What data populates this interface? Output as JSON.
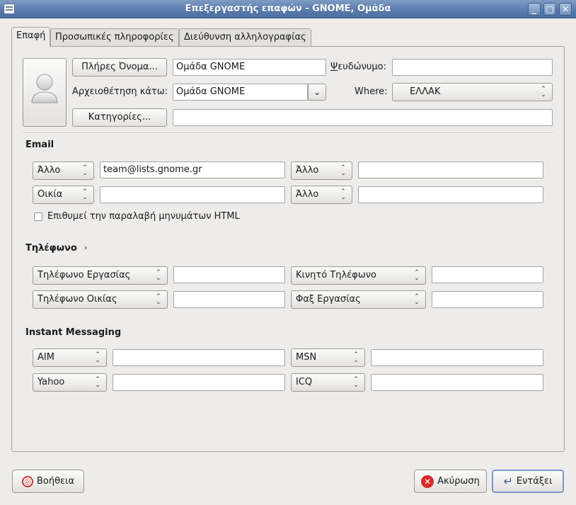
{
  "window": {
    "title": "Επεξεργαστής επαφών - GNOME, Ομάδα",
    "minimize_icon": "minimize-icon",
    "maximize_icon": "maximize-icon",
    "close_icon": "close-icon"
  },
  "tabs": [
    {
      "label": "Επαφή",
      "active": true
    },
    {
      "label": "Προσωπικές πληροφορίες",
      "active": false
    },
    {
      "label": "Διεύθυνση αλληλογραφίας",
      "active": false
    }
  ],
  "contact": {
    "full_name_button": "Πλήρες Όνομα...",
    "full_name_value": "Ομάδα GNOME",
    "nickname_label": "Ψευδώνυμο:",
    "nickname_value": "",
    "file_under_label": "Αρχειοθέτηση κάτω:",
    "file_under_value": "Ομάδα GNOME",
    "where_label": "Where:",
    "where_value": "ΕΛΛΑΚ",
    "categories_button": "Κατηγορίες...",
    "categories_value": "",
    "photo_icon": "person-icon"
  },
  "email": {
    "heading": "Email",
    "rows": [
      {
        "type1": "Άλλο",
        "value1": "team@lists.gnome.gr",
        "type2": "Άλλο",
        "value2": ""
      },
      {
        "type1": "Οικία",
        "value1": "",
        "type2": "Άλλο",
        "value2": ""
      }
    ],
    "html_checkbox_label": "Επιθυμεί την παραλαβή μηνυμάτων HTML",
    "html_checked": false
  },
  "phone": {
    "heading": "Τηλέφωνο",
    "expander_icon": "chevron-right-icon",
    "rows": [
      {
        "type1": "Τηλέφωνο Εργασίας",
        "value1": "",
        "type2": "Κινητό Τηλέφωνο",
        "value2": ""
      },
      {
        "type1": "Τηλέφωνο Οικίας",
        "value1": "",
        "type2": "Φαξ Εργασίας",
        "value2": ""
      }
    ]
  },
  "im": {
    "heading": "Instant Messaging",
    "rows": [
      {
        "type1": "AIM",
        "value1": "",
        "type2": "MSN",
        "value2": ""
      },
      {
        "type1": "Yahoo",
        "value1": "",
        "type2": "ICQ",
        "value2": ""
      }
    ]
  },
  "footer": {
    "help_button": "Βοήθεια",
    "cancel_button": "Ακύρωση",
    "ok_button": "Εντάξει"
  },
  "colors": {
    "titlebar": "#5a7daf",
    "cancel_icon": "#d92b2b",
    "help_icon": "#cc3333"
  }
}
